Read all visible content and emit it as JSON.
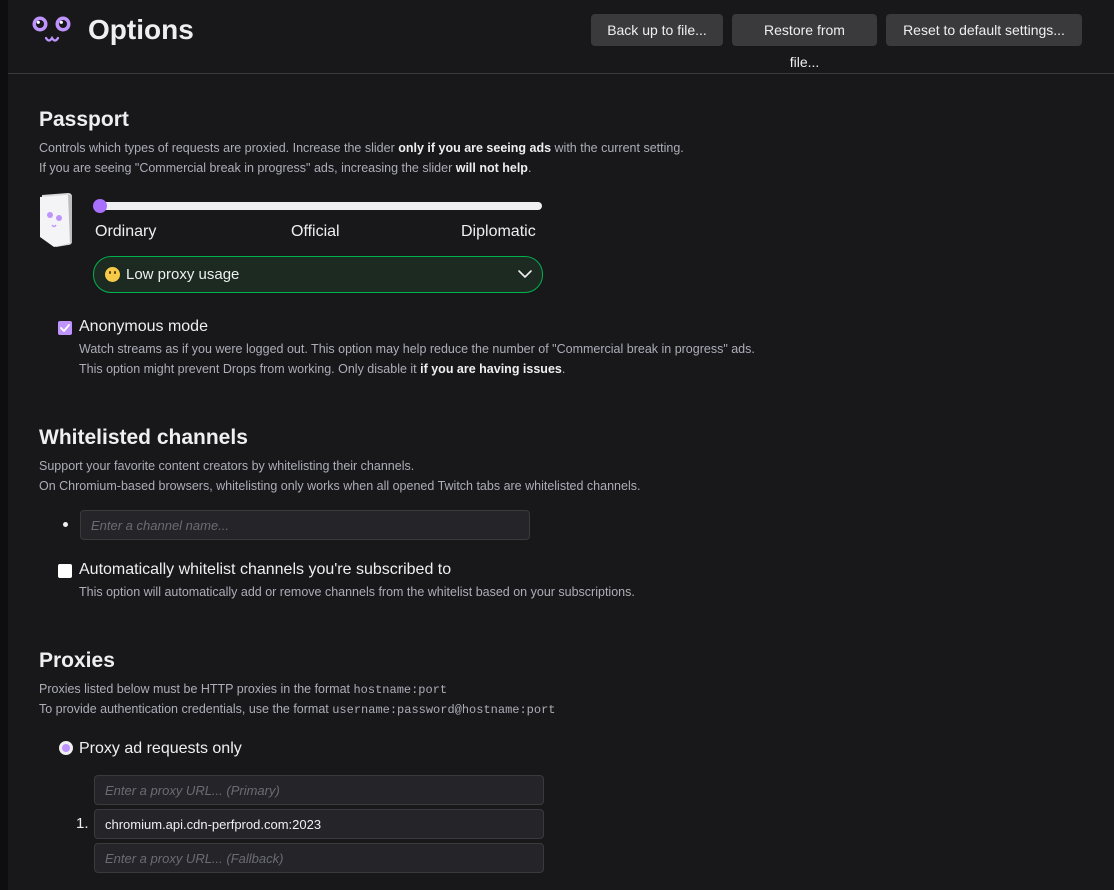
{
  "header": {
    "title": "Options",
    "backup_label": "Back up to file...",
    "restore_label": "Restore from file...",
    "reset_label": "Reset to default settings..."
  },
  "passport": {
    "title": "Passport",
    "desc_line1_a": "Controls which types of requests are proxied. Increase the slider ",
    "desc_line1_b": "only if you are seeing ads",
    "desc_line1_c": " with the current setting.",
    "desc_line2_a": "If you are seeing \"Commercial break in progress\" ads, increasing the slider ",
    "desc_line2_b": "will not help",
    "desc_line2_c": ".",
    "slider_level": 0,
    "slider_labels": [
      "Ordinary",
      "Official",
      "Diplomatic"
    ],
    "dropdown_value": "Low proxy usage"
  },
  "anonymous": {
    "checked": true,
    "label": "Anonymous mode",
    "desc_line1": "Watch streams as if you were logged out. This option may help reduce the number of \"Commercial break in progress\" ads.",
    "desc_line2_a": "This option might prevent Drops from working. Only disable it ",
    "desc_line2_b": "if you are having issues",
    "desc_line2_c": "."
  },
  "whitelist": {
    "title": "Whitelisted channels",
    "desc_line1": "Support your favorite content creators by whitelisting their channels.",
    "desc_line2": "On Chromium-based browsers, whitelisting only works when all opened Twitch tabs are whitelisted channels.",
    "input_placeholder": "Enter a channel name...",
    "auto_checked": false,
    "auto_label": "Automatically whitelist channels you're subscribed to",
    "auto_desc": "This option will automatically add or remove channels from the whitelist based on your subscriptions."
  },
  "proxies": {
    "title": "Proxies",
    "desc_line1_a": "Proxies listed below must be HTTP proxies in the format ",
    "desc_line1_code": "hostname:port",
    "desc_line2_a": "To provide authentication credentials, use the format ",
    "desc_line2_code": "username:password@hostname:port",
    "radio_label": "Proxy ad requests only",
    "primary_placeholder": "Enter a proxy URL... (Primary)",
    "list_number": "1.",
    "proxy_value": "chromium.api.cdn-perfprod.com:2023",
    "fallback_placeholder": "Enter a proxy URL... (Fallback)"
  },
  "colors": {
    "accent": "#bf94ff",
    "dropdown_border": "#00b14f"
  }
}
